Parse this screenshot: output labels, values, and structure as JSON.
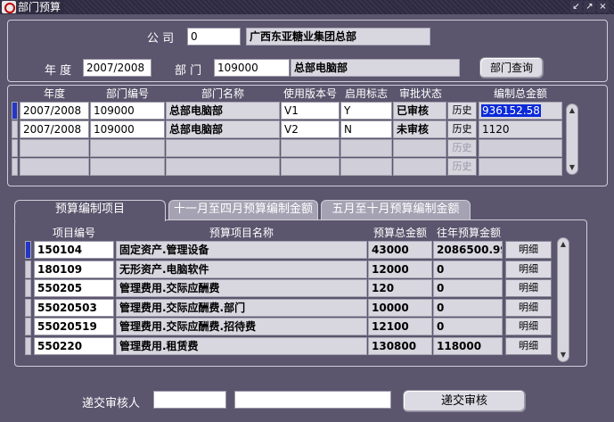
{
  "window": {
    "title": "部门预算",
    "controls": [
      "↙",
      "↗",
      "×"
    ]
  },
  "header": {
    "company_label": "公 司",
    "company_code": "0",
    "company_name": "广西东亚糖业集团总部",
    "year_label": "年 度",
    "year_value": "2007/2008",
    "dept_label": "部 门",
    "dept_code": "109000",
    "dept_name": "总部电脑部",
    "query_button": "部门查询"
  },
  "grid1": {
    "columns": [
      "年度",
      "部门编号",
      "部门名称",
      "使用版本号",
      "启用标志",
      "审批状态",
      "编制总金额"
    ],
    "history_label": "历史",
    "rows": [
      {
        "year": "2007/2008",
        "dept_code": "109000",
        "dept_name": "总部电脑部",
        "version": "V1",
        "flag": "Y",
        "status": "已审核",
        "amount": "936152.58"
      },
      {
        "year": "2007/2008",
        "dept_code": "109000",
        "dept_name": "总部电脑部",
        "version": "V2",
        "flag": "N",
        "status": "未审核",
        "amount": "1120"
      }
    ]
  },
  "tabs": [
    {
      "label": "预算编制项目"
    },
    {
      "label": "十一月至四月预算编制金额"
    },
    {
      "label": "五月至十月预算编制金额"
    }
  ],
  "grid2": {
    "columns": [
      "项目编号",
      "预算项目名称",
      "预算总金额",
      "往年预算金额"
    ],
    "detail_label": "明细",
    "rows": [
      {
        "code": "150104",
        "name": "固定资产.管理设备",
        "total": "43000",
        "prev": "2086500.99"
      },
      {
        "code": "180109",
        "name": "无形资产.电脑软件",
        "total": "12000",
        "prev": "0"
      },
      {
        "code": "550205",
        "name": "管理费用.交际应酬费",
        "total": "120",
        "prev": "0"
      },
      {
        "code": "55020503",
        "name": "管理费用.交际应酬费.部门",
        "total": "10000",
        "prev": "0"
      },
      {
        "code": "55020519",
        "name": "管理费用.交际应酬费.招待费",
        "total": "12100",
        "prev": "0"
      },
      {
        "code": "550220",
        "name": "管理费用.租赁费",
        "total": "130800",
        "prev": "118000"
      }
    ]
  },
  "footer": {
    "reviewer_label": "递交审核人",
    "reviewer_code": "",
    "reviewer_name": "",
    "submit_button": "递交审核"
  }
}
